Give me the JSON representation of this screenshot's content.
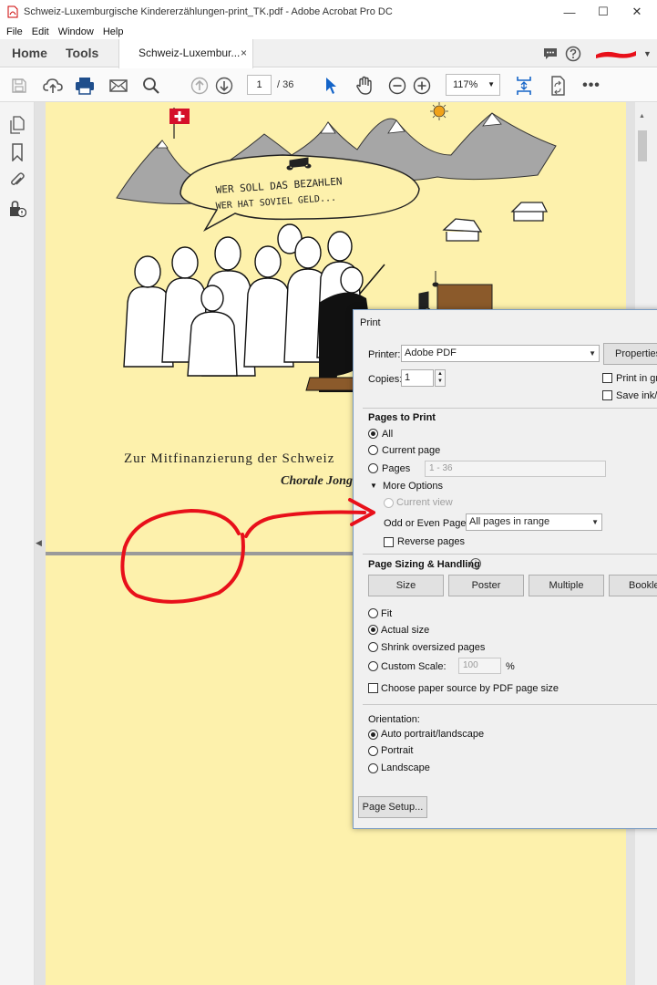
{
  "window": {
    "title": "Schweiz-Luxemburgische Kindererzählungen-print_TK.pdf - Adobe Acrobat Pro DC",
    "controls": {
      "minimize": "—",
      "maximize": "☐",
      "close": "✕"
    }
  },
  "menu": [
    "File",
    "Edit",
    "Window",
    "Help"
  ],
  "tabs": {
    "home": "Home",
    "tools": "Tools",
    "document": "Schweiz-Luxembur...",
    "close": "×"
  },
  "toolbar": {
    "page_current": "1",
    "page_total": "/ 36",
    "zoom": "117%"
  },
  "document": {
    "caption": "Zur Mitfinanzierung der Schweiz",
    "subcaption": "Chorale Jong L",
    "illustration_text": [
      "WER SOLL DAS BEZAHLEN",
      "WER HAT SOVIEL GELD..."
    ],
    "page_color": "#fdf1ac"
  },
  "print_dialog": {
    "title": "Print",
    "printer_label": "Printer:",
    "printer_value": "Adobe PDF",
    "properties": "Properties",
    "copies_label": "Copies:",
    "copies_value": "1",
    "print_grayscale": "Print in gra",
    "save_ink": "Save ink/to",
    "pages_to_print": "Pages to Print",
    "opt_all": "All",
    "opt_current": "Current page",
    "opt_pages": "Pages",
    "pages_range": "1 - 36",
    "more_options": "More Options",
    "current_view": "Current view",
    "odd_even_label": "Odd or Even Pages:",
    "odd_even_value": "All pages in range",
    "reverse_pages": "Reverse pages",
    "sizing_header": "Page Sizing & Handling",
    "btn_size": "Size",
    "btn_poster": "Poster",
    "btn_multiple": "Multiple",
    "btn_booklet": "Bookle",
    "fit": "Fit",
    "actual_size": "Actual size",
    "shrink": "Shrink oversized pages",
    "custom_scale": "Custom Scale:",
    "custom_scale_value": "100",
    "percent": "%",
    "paper_source": "Choose paper source by PDF page size",
    "orientation_label": "Orientation:",
    "auto_orient": "Auto portrait/landscape",
    "portrait": "Portrait",
    "landscape": "Landscape",
    "page_setup": "Page Setup..."
  },
  "colors": {
    "accent": "#1473e6",
    "annotation": "#e8101a",
    "page": "#fdf1ac"
  }
}
